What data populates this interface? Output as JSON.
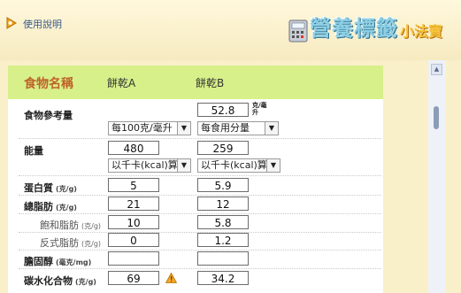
{
  "header": {
    "help_label": "使用說明",
    "brand_title": "營養標籤",
    "brand_subtitle": "小法寶"
  },
  "table": {
    "name_header": "食物名稱",
    "food_a_name": "餅乾A",
    "food_b_name": "餅乾B",
    "reference": {
      "label": "食物參考量",
      "b_value": "52.8",
      "b_unit": "克/毫升",
      "a_select": "每100克/毫升",
      "b_select": "每食用分量"
    },
    "energy": {
      "label": "能量",
      "a_value": "480",
      "b_value": "259",
      "a_select": "以千卡(kcal)算",
      "b_select": "以千卡(kcal)算"
    },
    "protein": {
      "label": "蛋白質",
      "unit": "(克/g)",
      "a_value": "5",
      "b_value": "5.9"
    },
    "total_fat": {
      "label": "總脂肪",
      "unit": "(克/g)",
      "a_value": "21",
      "b_value": "12"
    },
    "saturated_fat": {
      "label": "飽和脂肪",
      "unit": "(克/g)",
      "a_value": "10",
      "b_value": "5.8"
    },
    "trans_fat": {
      "label": "反式脂肪",
      "unit": "(克/g)",
      "a_value": "0",
      "b_value": "1.2"
    },
    "cholesterol": {
      "label": "膽固醇",
      "unit": "(毫克/mg)",
      "a_value": "",
      "b_value": ""
    },
    "carbohydrate": {
      "label": "碳水化合物",
      "unit": "(克/g)",
      "a_value": "69",
      "b_value": "34.2"
    }
  },
  "icons": {
    "help": "help-arrow-icon",
    "calculator": "calculator-icon",
    "warning": "warning-icon",
    "scroll_up": "scroll-up-arrow-icon"
  },
  "colors": {
    "header_band": "#d7f08a",
    "title_text": "#c0622a",
    "page_background": "#f9efc9",
    "warning": "#f5a623"
  }
}
